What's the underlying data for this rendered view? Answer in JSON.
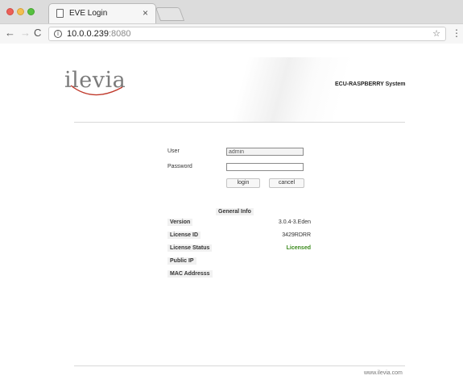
{
  "browser": {
    "tab_title": "EVE Login",
    "tab_close": "×",
    "url_host": "10.0.0.239",
    "url_port": ":8080"
  },
  "icons": {
    "back": "arrow-left-icon",
    "forward": "arrow-right-icon",
    "reload": "reload-icon",
    "info": "info-icon",
    "bookmark": "star-icon",
    "menu": "menu-dots-icon"
  },
  "header": {
    "logo_text": "ilevia",
    "system_title": "ECU-RASPBERRY System"
  },
  "login": {
    "user_label": "User",
    "user_value": "admin",
    "password_label": "Password",
    "password_value": "",
    "login_button": "login",
    "cancel_button": "cancel"
  },
  "general_info": {
    "title": "General Info",
    "rows": [
      {
        "key": "Version",
        "value": "3.0.4-3.Eden"
      },
      {
        "key": "License ID",
        "value": "3429RDRR"
      },
      {
        "key": "License Status",
        "value": "Licensed"
      },
      {
        "key": "Public IP",
        "value": ""
      },
      {
        "key": "MAC Addresss",
        "value": ""
      }
    ]
  },
  "footer": {
    "link": "www.ilevia.com"
  },
  "colors": {
    "logo_arc": "#c0392b",
    "licensed": "#3a8a1c"
  }
}
